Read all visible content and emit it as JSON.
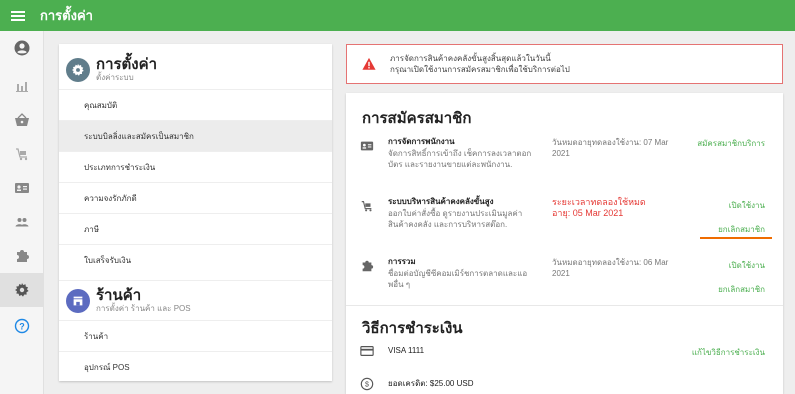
{
  "app": {
    "title": "การตั้งค่า"
  },
  "colors": {
    "brand": "#4caf50",
    "danger": "#e53935",
    "highlight": "#ef6c00",
    "avatar": "#607d8b",
    "store_icon": "#5c6bc0"
  },
  "rail": {
    "items": [
      {
        "icon": "account-circle-icon"
      },
      {
        "icon": "bar-chart-icon"
      },
      {
        "icon": "shopping-basket-icon"
      },
      {
        "icon": "cart-icon"
      },
      {
        "icon": "id-card-icon"
      },
      {
        "icon": "people-icon"
      },
      {
        "icon": "puzzle-icon"
      },
      {
        "icon": "gear-icon",
        "active": true
      },
      {
        "icon": "help-icon"
      }
    ]
  },
  "settings_section": {
    "title": "การตั้งค่า",
    "subtitle": "ตั้งค่าระบบ",
    "items": [
      "คุณสมบัติ",
      "ระบบบิลลิ่งและสมัครเป็นสมาชิก",
      "ประเภทการชำระเงิน",
      "ความจงรักภักดี",
      "ภาษี",
      "ใบเสร็จรับเงิน"
    ]
  },
  "store_section": {
    "title": "ร้านค้า",
    "subtitle": "การตั้งค่า ร้านค้า และ POS",
    "items": [
      "ร้านค้า",
      "อุปกรณ์ POS"
    ]
  },
  "alert": {
    "line1": "ภารจัดการสินค้าคงคลังขั้นสูงสิ้นสุดแล้วในวันนี้",
    "line2": "กรุณาเปิดใช้งานการสมัครสมาชิกเพื่อใช้บริการต่อไป"
  },
  "subscriptions": {
    "title": "การสมัครสมาชิก",
    "rows": [
      {
        "name": "การจัดการพนักงาน",
        "desc": "จัดการสิทธิ์การเข้าถึง เช็คการลงเวลาตอกบัตร และรายงานขายแต่ละพนักงาน.",
        "status": "วันหมดอายุทดลองใช้งาน: 07 Mar 2021",
        "action": "สมัครสมาชิกบริการ"
      },
      {
        "name": "ระบบบริหารสินค้าคงคลังขั้นสูง",
        "desc": "ออกใบค่าสั่งซื้อ ดูรายงานประเมินมูลค่าสินค้าคงคลัง และการบริหารสต๊อก.",
        "status": "ระยะเวลาทดลองใช้หมดอายุ: 05 Mar 2021",
        "action": "เปิดใช้งาน",
        "action2": "ยกเลิกสมาชิก"
      },
      {
        "name": "การรวม",
        "desc": "ชื่อมต่อบัญชีซีคอมเมิร์ชการตลาดและแอพอื่น ๆ",
        "status": "วันหมดอายุทดลองใช้งาน: 06 Mar 2021",
        "action": "เปิดใช้งาน",
        "action2": "ยกเลิกสมาชิก"
      }
    ]
  },
  "payment": {
    "title": "วิธีการชำระเงิน",
    "card": "VISA 1111",
    "change_action": "แก้ไขวิธีการชำระเงิน",
    "credit": "ยอดเครดิต: $25.00 USD"
  }
}
